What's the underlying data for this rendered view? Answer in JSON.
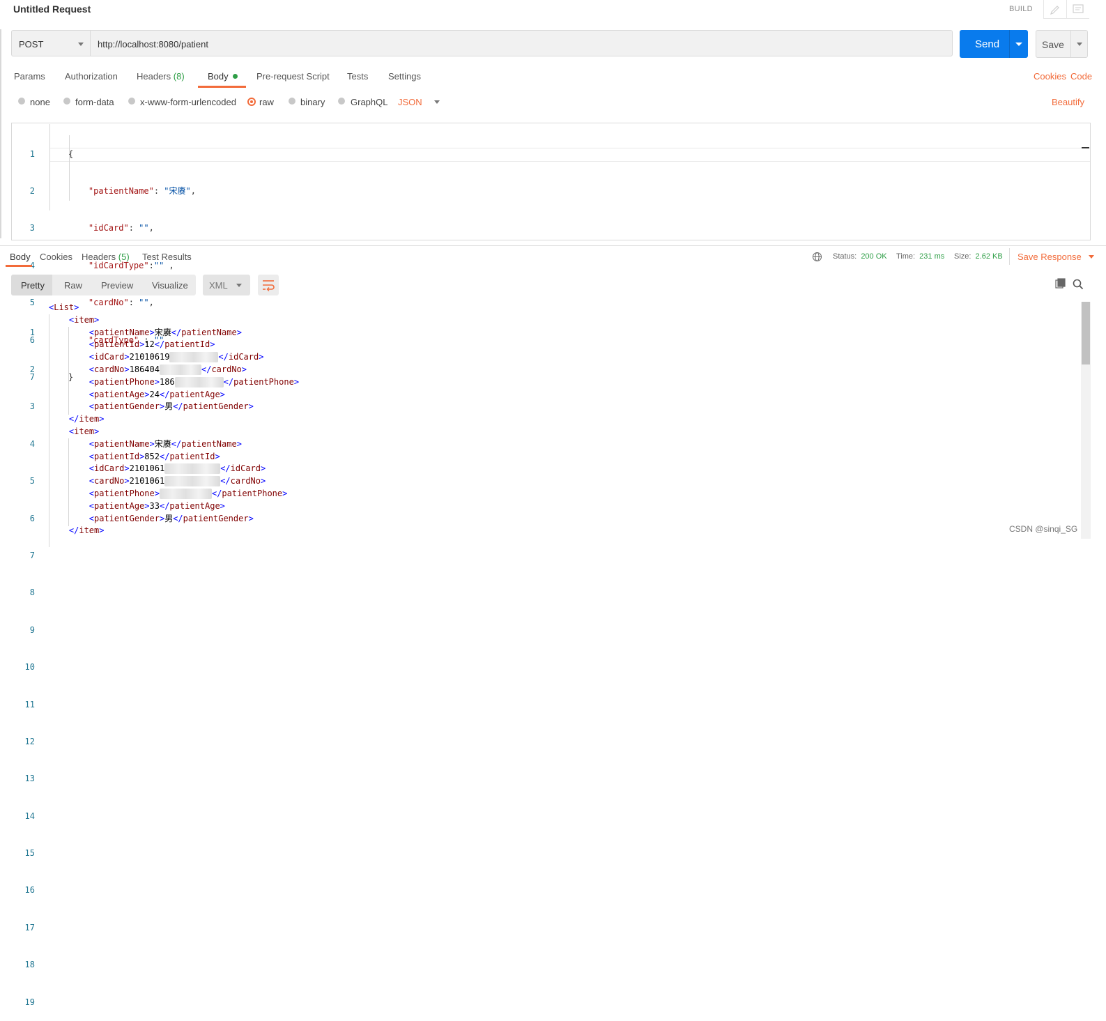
{
  "header": {
    "title": "Untitled Request",
    "build_label": "BUILD"
  },
  "request": {
    "method": "POST",
    "url": "http://localhost:8080/patient",
    "send_label": "Send",
    "save_label": "Save"
  },
  "request_tabs": {
    "params": "Params",
    "authorization": "Authorization",
    "headers": "Headers",
    "headers_count": "(8)",
    "body": "Body",
    "prerequest": "Pre-request Script",
    "tests": "Tests",
    "settings": "Settings",
    "cookies_link": "Cookies",
    "code_link": "Code"
  },
  "body_types": {
    "none": "none",
    "form_data": "form-data",
    "urlencoded": "x-www-form-urlencoded",
    "raw": "raw",
    "binary": "binary",
    "graphql": "GraphQL",
    "format": "JSON",
    "beautify": "Beautify",
    "selected": "raw"
  },
  "request_body": {
    "line_numbers": [
      "1",
      "2",
      "3",
      "4",
      "5",
      "6",
      "7"
    ],
    "l1": "{",
    "l2_key": "\"patientName\"",
    "l2_sep": ": ",
    "l2_val": "\"宋赓\"",
    "l2_end": ",",
    "l3_key": "\"idCard\"",
    "l3_sep": ": ",
    "l3_val": "\"\"",
    "l3_end": ",",
    "l4_key": "\"idCardType\"",
    "l4_sep": ":",
    "l4_val": "\"\"",
    "l4_end": " ,",
    "l5_key": "\"cardNo\"",
    "l5_sep": ": ",
    "l5_val": "\"\"",
    "l5_end": ",",
    "l6_key": "\"cardType\"",
    "l6_sep": " : ",
    "l6_val": "\"\"",
    "l7": "}"
  },
  "response_tabs": {
    "body": "Body",
    "cookies": "Cookies",
    "headers": "Headers",
    "headers_count": "(5)",
    "test_results": "Test Results"
  },
  "response_meta": {
    "status_label": "Status:",
    "status_value": "200 OK",
    "time_label": "Time:",
    "time_value": "231 ms",
    "size_label": "Size:",
    "size_value": "2.62 KB",
    "save_response": "Save Response"
  },
  "view_modes": {
    "pretty": "Pretty",
    "raw": "Raw",
    "preview": "Preview",
    "visualize": "Visualize",
    "format": "XML"
  },
  "response_body": {
    "line_numbers": [
      "1",
      "2",
      "3",
      "4",
      "5",
      "6",
      "7",
      "8",
      "9",
      "10",
      "11",
      "12",
      "13",
      "14",
      "15",
      "16",
      "17",
      "18",
      "19"
    ],
    "list_tag": "List",
    "item_tag": "item",
    "item1": {
      "patientName": "宋赓",
      "patientId": "12",
      "idCard_prefix": "21010619",
      "cardNo_prefix": "186404",
      "patientPhone_prefix": "186",
      "patientAge": "24",
      "patientGender": "男"
    },
    "item2": {
      "patientName": "宋赓",
      "patientId": "852",
      "idCard_prefix": "2101061",
      "cardNo_prefix": "2101061",
      "patientPhone_prefix": "",
      "patientAge": "33",
      "patientGender": "男"
    }
  },
  "watermark": "CSDN @sinqi_SG",
  "colors": {
    "accent": "#f26b3a",
    "send_button": "#097bed",
    "status_ok": "#2e9e46"
  }
}
